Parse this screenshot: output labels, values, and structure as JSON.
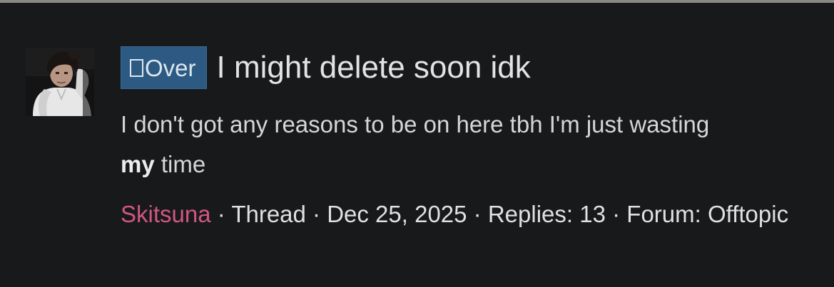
{
  "result": {
    "prefix_icon": "square-glyph-icon",
    "prefix_label": "Over",
    "title": "I might delete soon idk",
    "snippet_before": "I don't got any reasons to be on here tbh I'm just wasting ",
    "snippet_highlight": "my",
    "snippet_after": " time",
    "meta": {
      "username": "Skitsuna",
      "separator": " · ",
      "content_type": "Thread",
      "date": "Dec 25, 2025",
      "replies": "Replies: 13",
      "forum_label": "Forum:",
      "forum_name": "Offtopic"
    }
  },
  "colors": {
    "background": "#18191b",
    "prefix_background": "#2c5a82",
    "username": "#d1577f",
    "text": "#e3e3e3"
  }
}
